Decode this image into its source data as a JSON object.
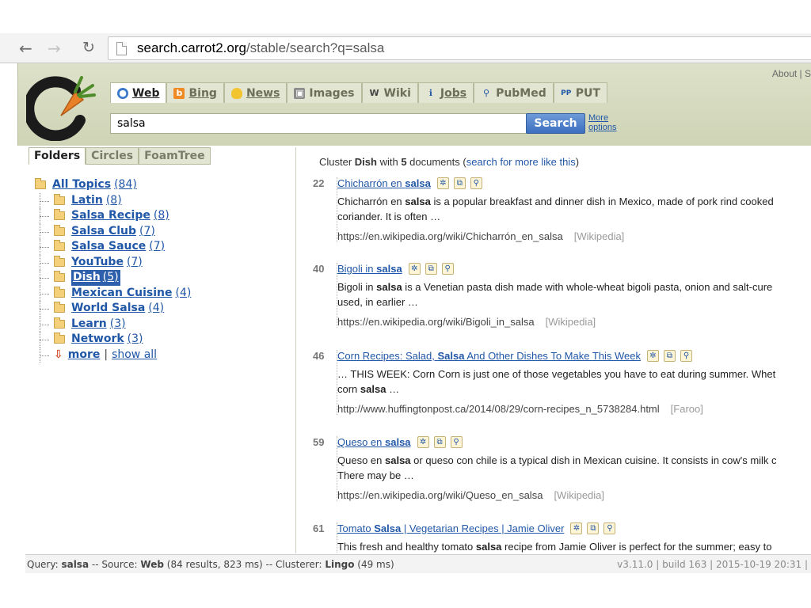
{
  "browser": {
    "url_host": "search.carrot2.org",
    "url_path": "/stable/search?q=salsa"
  },
  "header": {
    "about_label": "About",
    "tabs": [
      {
        "label": "Web",
        "icon": "globe-icon"
      },
      {
        "label": "Bing",
        "icon": "bing-icon"
      },
      {
        "label": "News",
        "icon": "news-icon"
      },
      {
        "label": "Images",
        "icon": "images-icon"
      },
      {
        "label": "Wiki",
        "icon": "wiki-icon"
      },
      {
        "label": "Jobs",
        "icon": "jobs-icon"
      },
      {
        "label": "PubMed",
        "icon": "pubmed-icon"
      },
      {
        "label": "PUT",
        "icon": "put-icon"
      }
    ],
    "search_value": "salsa",
    "search_button": "Search",
    "more_options_1": "More",
    "more_options_2": "options"
  },
  "left_panel": {
    "view_tabs": [
      "Folders",
      "Circles",
      "FoamTree"
    ],
    "root": {
      "label": "All Topics",
      "count": "(84)"
    },
    "folders": [
      {
        "label": "Latin",
        "count": "(8)"
      },
      {
        "label": "Salsa Recipe",
        "count": "(8)"
      },
      {
        "label": "Salsa Club",
        "count": "(7)"
      },
      {
        "label": "Salsa Sauce",
        "count": "(7)"
      },
      {
        "label": "YouTube",
        "count": "(7)"
      },
      {
        "label": "Dish",
        "count": "(5)"
      },
      {
        "label": "Mexican Cuisine",
        "count": "(4)"
      },
      {
        "label": "World Salsa",
        "count": "(4)"
      },
      {
        "label": "Learn",
        "count": "(3)"
      },
      {
        "label": "Network",
        "count": "(3)"
      }
    ],
    "more_label": "more",
    "show_all_label": "show all"
  },
  "right_panel": {
    "cluster_prefix": "Cluster ",
    "cluster_name": "Dish",
    "cluster_mid": " with ",
    "cluster_count": "5",
    "cluster_suffix": " documents (",
    "cluster_link": "search for more like this",
    "cluster_end": ")",
    "docs": [
      {
        "rank": "22",
        "title_pre": "Chicharrón en ",
        "title_bold": "salsa",
        "title_post": "",
        "snippet1_pre": "Chicharrón en ",
        "snippet1_bold": "salsa",
        "snippet1_post": " is a popular breakfast and dinner dish in Mexico, made of pork rind cooked",
        "snippet2": "coriander. It is often …",
        "url": "https://en.wikipedia.org/wiki/Chicharrón_en_salsa",
        "source": "[Wikipedia]"
      },
      {
        "rank": "40",
        "title_pre": "Bigoli in ",
        "title_bold": "salsa",
        "title_post": "",
        "snippet1_pre": "Bigoli in ",
        "snippet1_bold": "salsa",
        "snippet1_post": " is a Venetian pasta dish made with whole-wheat bigoli pasta, onion and salt-cure",
        "snippet2": "used, in earlier …",
        "url": "https://en.wikipedia.org/wiki/Bigoli_in_salsa",
        "source": "[Wikipedia]"
      },
      {
        "rank": "46",
        "title_pre": "Corn Recipes: Salad, ",
        "title_bold": "Salsa",
        "title_post": " And Other Dishes To Make This Week",
        "snippet1_pre": "… THIS WEEK: Corn Corn is just one of those vegetables you have to eat during summer. Whet",
        "snippet1_bold": "",
        "snippet1_post": "",
        "snippet2_pre": "corn ",
        "snippet2_bold": "salsa",
        "snippet2_post": " …",
        "url": "http://www.huffingtonpost.ca/2014/08/29/corn-recipes_n_5738284.html",
        "source": "[Faroo]"
      },
      {
        "rank": "59",
        "title_pre": "Queso en ",
        "title_bold": "salsa",
        "title_post": "",
        "snippet1_pre": "Queso en ",
        "snippet1_bold": "salsa",
        "snippet1_post": " or queso con chile is a typical dish in Mexican cuisine. It consists in cow's milk c",
        "snippet2": "There may be …",
        "url": "https://en.wikipedia.org/wiki/Queso_en_salsa",
        "source": "[Wikipedia]"
      },
      {
        "rank": "61",
        "title_pre": "Tomato ",
        "title_bold": "Salsa",
        "title_post": " | Vegetarian Recipes | Jamie Oliver",
        "snippet1_pre": "This fresh and healthy tomato ",
        "snippet1_bold": "salsa",
        "snippet1_post": " recipe from Jamie Oliver is perfect for the summer; easy to"
      }
    ]
  },
  "status": {
    "query_label": "Query: ",
    "query": "salsa",
    "source_label": " -- Source: ",
    "source": "Web",
    "results": " (84 results, 823 ms) -- Clusterer: ",
    "clusterer": "Lingo",
    "clusterer_time": " (49 ms)",
    "version": "v3.11.0 | build 163 | 2015-10-19 20:31 |"
  },
  "colors": {
    "link": "#2157a7",
    "header_bg": "#d6dbbf",
    "selected": "#2d5fad"
  }
}
